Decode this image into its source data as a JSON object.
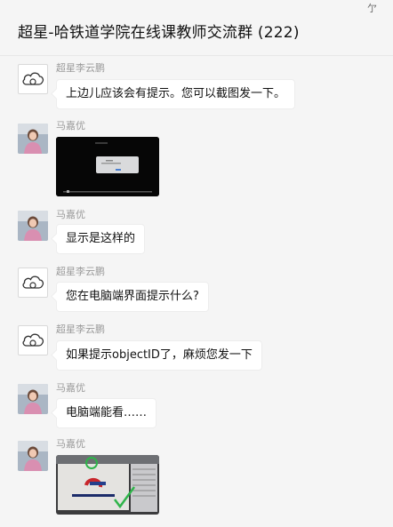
{
  "window": {
    "pin_icon": "pin-icon",
    "pin_glyph": "亇"
  },
  "chat": {
    "title": "超星-哈铁道学院在线课教师交流群 (222)"
  },
  "messages": [
    {
      "sender": "超星李云鹏",
      "text": "上边儿应该会有提示。您可以截图发一下。",
      "avatar": "cloud-icon"
    },
    {
      "sender": "马嘉优",
      "type": "image",
      "avatar": "photo-avatar",
      "image": "dark-screenshot"
    },
    {
      "sender": "马嘉优",
      "text": "显示是这样的",
      "avatar": "photo-avatar"
    },
    {
      "sender": "超星李云鹏",
      "text": "您在电脑端界面提示什么?",
      "avatar": "cloud-icon"
    },
    {
      "sender": "超星李云鹏",
      "text": "如果提示objectID了，麻烦您发一下",
      "avatar": "cloud-icon"
    },
    {
      "sender": "马嘉优",
      "text": "电脑端能看……",
      "avatar": "photo-avatar"
    },
    {
      "sender": "马嘉优",
      "type": "image",
      "avatar": "photo-avatar",
      "image": "monitor-photo"
    }
  ],
  "colors": {
    "background": "#f5f5f5",
    "bubble": "#ffffff",
    "sender": "#9a9a9a",
    "text": "#111111"
  }
}
